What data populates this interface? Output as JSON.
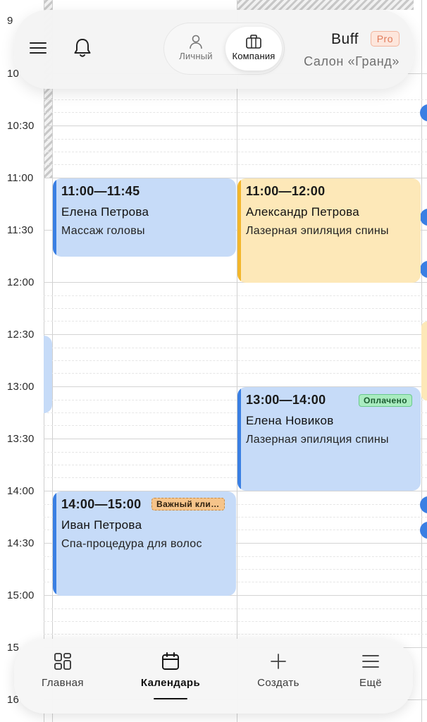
{
  "header": {
    "mode_toggle": {
      "personal_label": "Личный",
      "company_label": "Компания",
      "selected": "Компания"
    },
    "user_name": "Buff",
    "plan_badge": "Pro",
    "salon_name": "Салон «Гранд»"
  },
  "calendar": {
    "time_labels": [
      "9",
      "10",
      "10:30",
      "11:00",
      "11:30",
      "12:00",
      "12:30",
      "13:00",
      "13:30",
      "14:00",
      "14:30",
      "15:00",
      "15",
      "16"
    ],
    "events": [
      {
        "time": "11:00—11:45",
        "client": "Елена Петрова",
        "service": "Массаж головы",
        "color": "#c6dbf8",
        "accent": "#3a7fe3"
      },
      {
        "time": "11:00—12:00",
        "client": "Александр Петрова",
        "service": "Лазерная эпиляция спины",
        "color": "#fde8b8",
        "accent": "#f2b62c"
      },
      {
        "time": "13:00—14:00",
        "client": "Елена Новиков",
        "service": "Лазерная эпиляция спины",
        "tag": "Оплачено",
        "color": "#c6dbf8",
        "accent": "#3a7fe3"
      },
      {
        "time": "14:00—15:00",
        "client": "Иван Петрова",
        "service": "Спа-процедура для волос",
        "tag": "Важный клиент",
        "color": "#c6dbf8",
        "accent": "#3a7fe3"
      }
    ]
  },
  "bottom_nav": {
    "items": [
      {
        "label": "Главная",
        "icon": "grid-icon"
      },
      {
        "label": "Календарь",
        "icon": "calendar-icon"
      },
      {
        "label": "Создать",
        "icon": "plus-icon"
      },
      {
        "label": "Ещё",
        "icon": "menu-icon"
      }
    ],
    "active": "Календарь"
  },
  "colors": {
    "accent_blue": "#3a7fe3",
    "accent_yellow": "#f2b62c",
    "paid_green": "#a9ecc0",
    "important_orange": "#f5c48a",
    "pro_badge": "#e07a5a"
  }
}
